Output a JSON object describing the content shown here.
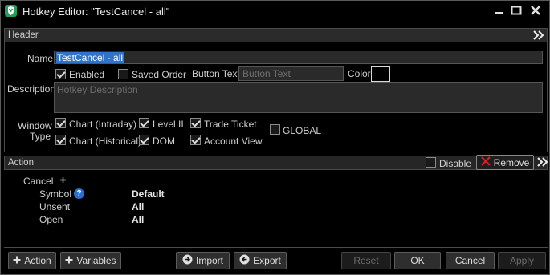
{
  "window": {
    "title": "Hotkey Editor: \"TestCancel - all\"",
    "icon": "shield-icon",
    "brand_color": "#22a05a"
  },
  "header": {
    "label": "Header",
    "name_label": "Name",
    "name_value": "TestCancel - all",
    "enabled_label": "Enabled",
    "enabled_checked": true,
    "saved_order_label": "Saved Order",
    "saved_order_checked": false,
    "button_text_label": "Button Text",
    "button_text_placeholder": "Button Text",
    "color_label": "Color",
    "color_value": "#000000",
    "description_label": "Description",
    "description_placeholder": "Hotkey Description",
    "window_type_label_1": "Window",
    "window_type_label_2": "Type",
    "window_types": [
      {
        "label": "Chart (Intraday)",
        "checked": true
      },
      {
        "label": "Level II",
        "checked": true
      },
      {
        "label": "Trade Ticket",
        "checked": true
      },
      {
        "label": "Chart (Historical)",
        "checked": true
      },
      {
        "label": "DOM",
        "checked": true
      },
      {
        "label": "Account View",
        "checked": true
      }
    ],
    "global_label": "GLOBAL",
    "global_checked": false
  },
  "action": {
    "label": "Action",
    "disable_label": "Disable",
    "disable_checked": false,
    "remove_label": "Remove",
    "remove_color": "#e02020",
    "tree": {
      "root": "Cancel",
      "rows": [
        {
          "key": "Symbol",
          "value": "Default",
          "help": true
        },
        {
          "key": "Unsent",
          "value": "All"
        },
        {
          "key": "Open",
          "value": "All"
        }
      ]
    }
  },
  "footer": {
    "add_action": "Action",
    "add_variables": "Variables",
    "import": "Import",
    "export": "Export",
    "reset": "Reset",
    "ok": "OK",
    "cancel": "Cancel",
    "apply": "Apply"
  }
}
